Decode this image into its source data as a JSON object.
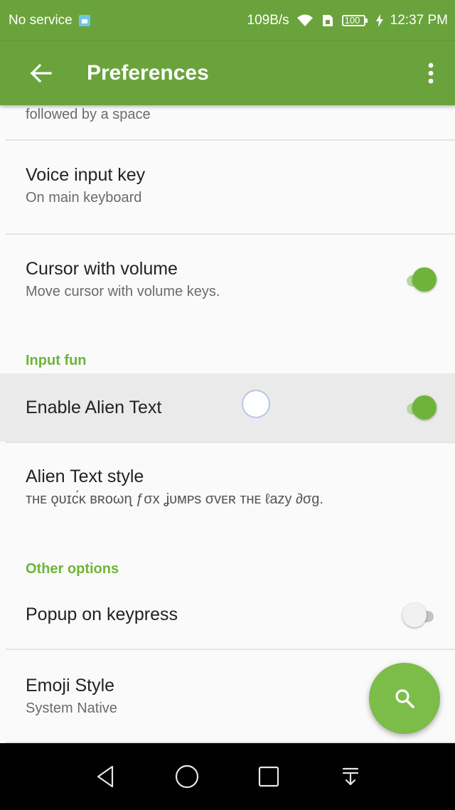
{
  "status_bar": {
    "carrier": "No service",
    "net_speed": "109B/s",
    "battery": "100",
    "time": "12:37 PM"
  },
  "app_bar": {
    "title": "Preferences",
    "back_icon": "arrow-back-icon",
    "overflow_icon": "more-vert-icon"
  },
  "preferences": {
    "partial_summary": "followed by a space",
    "voice_input_key": {
      "title": "Voice input key",
      "summary": "On main keyboard"
    },
    "cursor_with_volume": {
      "title": "Cursor with volume",
      "summary": "Move cursor with volume keys.",
      "enabled": true
    },
    "input_fun_header": "Input fun",
    "enable_alien_text": {
      "title": "Enable Alien Text",
      "enabled": true
    },
    "alien_text_style": {
      "title": "Alien Text style",
      "summary": "ᴛʜᴇ ǫᴜɪᴄ́ᴋ ʙʀᴏωɳ ƒσx ʝᴜᴍᴘs σᴠᴇʀ ᴛʜᴇ ℓazy ∂σg."
    },
    "other_options_header": "Other options",
    "popup_on_keypress": {
      "title": "Popup on keypress",
      "enabled": false
    },
    "emoji_style": {
      "title": "Emoji Style",
      "summary": "System Native"
    }
  },
  "fab": {
    "icon": "search-icon"
  },
  "nav_bar": {
    "icons": [
      "back-triangle-icon",
      "home-circle-icon",
      "recents-square-icon",
      "notification-pull-icon"
    ]
  },
  "colors": {
    "primary": "#6aa33c",
    "accent": "#6fb43a",
    "fab": "#7cbd4a"
  }
}
